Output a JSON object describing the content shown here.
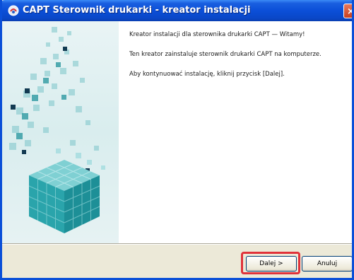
{
  "window": {
    "title": "CAPT Sterownik drukarki - kreator instalacji",
    "close_label": "×"
  },
  "main": {
    "heading": "Kreator instalacji dla sterownika drukarki CAPT — Witamy!",
    "description": "Ten kreator zainstaluje sterownik drukarki CAPT na komputerze.",
    "instruction": "Aby kontynuować instalację, kliknij przycisk [Dalej]."
  },
  "buttons": {
    "next_label": "Dalej >",
    "cancel_label": "Anuluj"
  },
  "colors": {
    "titlebar": "#0a4fd8",
    "highlight": "#e0323a",
    "art_cube": "#3fb3b8"
  }
}
